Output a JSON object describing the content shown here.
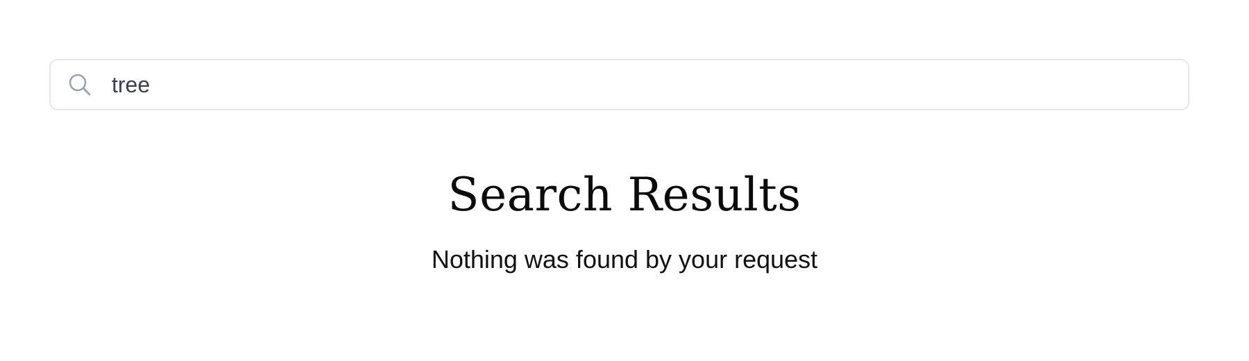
{
  "search": {
    "value": "tree",
    "icon": "search-icon"
  },
  "main": {
    "title": "Search Results",
    "message": "Nothing was found by your request"
  },
  "colors": {
    "border": "#e5e7eb",
    "icon": "#9ca3af",
    "input_text": "#374151",
    "heading": "#0b0b0b"
  }
}
